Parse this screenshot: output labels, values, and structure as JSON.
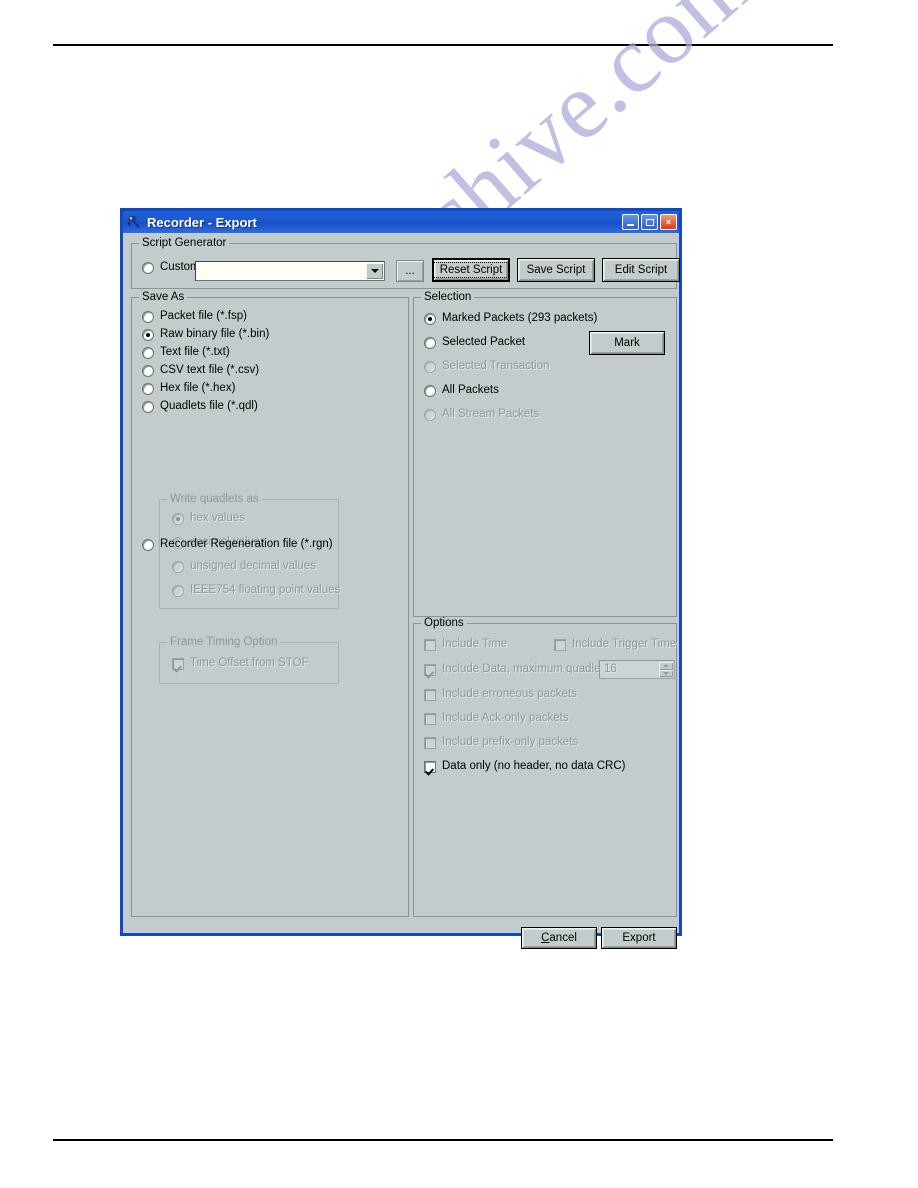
{
  "window": {
    "title": "Recorder - Export",
    "icon": "recorder-icon",
    "buttons": {
      "minimize": "minimize-icon",
      "maximize": "maximize-icon",
      "close": "×"
    }
  },
  "watermark": {
    "text": "manualarchive.com"
  },
  "script_generator": {
    "legend": "Script Generator",
    "custom_label": "Custom",
    "custom_selected": false,
    "combo_value": "",
    "browse_label": "...",
    "reset_label": "Reset Script",
    "save_label": "Save Script",
    "edit_label": "Edit Script"
  },
  "save_as": {
    "legend": "Save As",
    "options": [
      {
        "label": "Packet file (*.fsp)",
        "selected": false,
        "enabled": true
      },
      {
        "label": "Raw binary file (*.bin)",
        "selected": true,
        "enabled": true
      },
      {
        "label": "Text file (*.txt)",
        "selected": false,
        "enabled": true
      },
      {
        "label": "CSV text file (*.csv)",
        "selected": false,
        "enabled": true
      },
      {
        "label": "Hex file (*.hex)",
        "selected": false,
        "enabled": true
      },
      {
        "label": "Quadlets file (*.qdl)",
        "selected": false,
        "enabled": true
      }
    ],
    "quadlets": {
      "legend": "Write quadlets as",
      "enabled": false,
      "options": [
        {
          "label": "hex values",
          "selected": true
        },
        {
          "label": "decimal values",
          "selected": false
        },
        {
          "label": "unsigned decimal values",
          "selected": false
        },
        {
          "label": "IEEE754 floating point values",
          "selected": false
        }
      ]
    },
    "regeneration": {
      "label": "Recorder Regeneration file (*.rgn)",
      "selected": false,
      "enabled": true
    },
    "frame_timing": {
      "legend": "Frame Timing Option",
      "enabled": false,
      "option": {
        "label": "Time Offset from STOF",
        "checked": true
      }
    }
  },
  "selection": {
    "legend": "Selection",
    "options": [
      {
        "label": "Marked Packets (293 packets)",
        "selected": true,
        "enabled": true
      },
      {
        "label": "Selected Packet",
        "selected": false,
        "enabled": true
      },
      {
        "label": "Selected Transaction",
        "selected": false,
        "enabled": false
      },
      {
        "label": "All Packets",
        "selected": false,
        "enabled": true
      },
      {
        "label": "All Stream Packets",
        "selected": false,
        "enabled": false
      }
    ],
    "mark_label": "Mark"
  },
  "options": {
    "legend": "Options",
    "include_time": {
      "label": "Include Time",
      "checked": false,
      "enabled": false
    },
    "include_trigger_time": {
      "label": "Include Trigger Time",
      "checked": false,
      "enabled": false
    },
    "include_data": {
      "label": "Include Data, maximum quadlets:",
      "checked": true,
      "enabled": false
    },
    "max_quadlets_value": "16",
    "include_erroneous": {
      "label": "Include erroneous packets",
      "checked": false,
      "enabled": false
    },
    "include_ack_only": {
      "label": "Include Ack-only packets",
      "checked": false,
      "enabled": false
    },
    "include_prefix_only": {
      "label": "Include prefix-only packets",
      "checked": false,
      "enabled": false
    },
    "data_only": {
      "label": "Data only (no header, no data CRC)",
      "checked": true,
      "enabled": true
    }
  },
  "footer": {
    "cancel_accel": "C",
    "cancel_rest": "ancel",
    "export_label": "Export"
  },
  "colors": {
    "dialog_face": "#c2cccc",
    "title_blue": "#1148c4",
    "field_cream": "#fffef4",
    "watermark": "#a7a8d8"
  }
}
